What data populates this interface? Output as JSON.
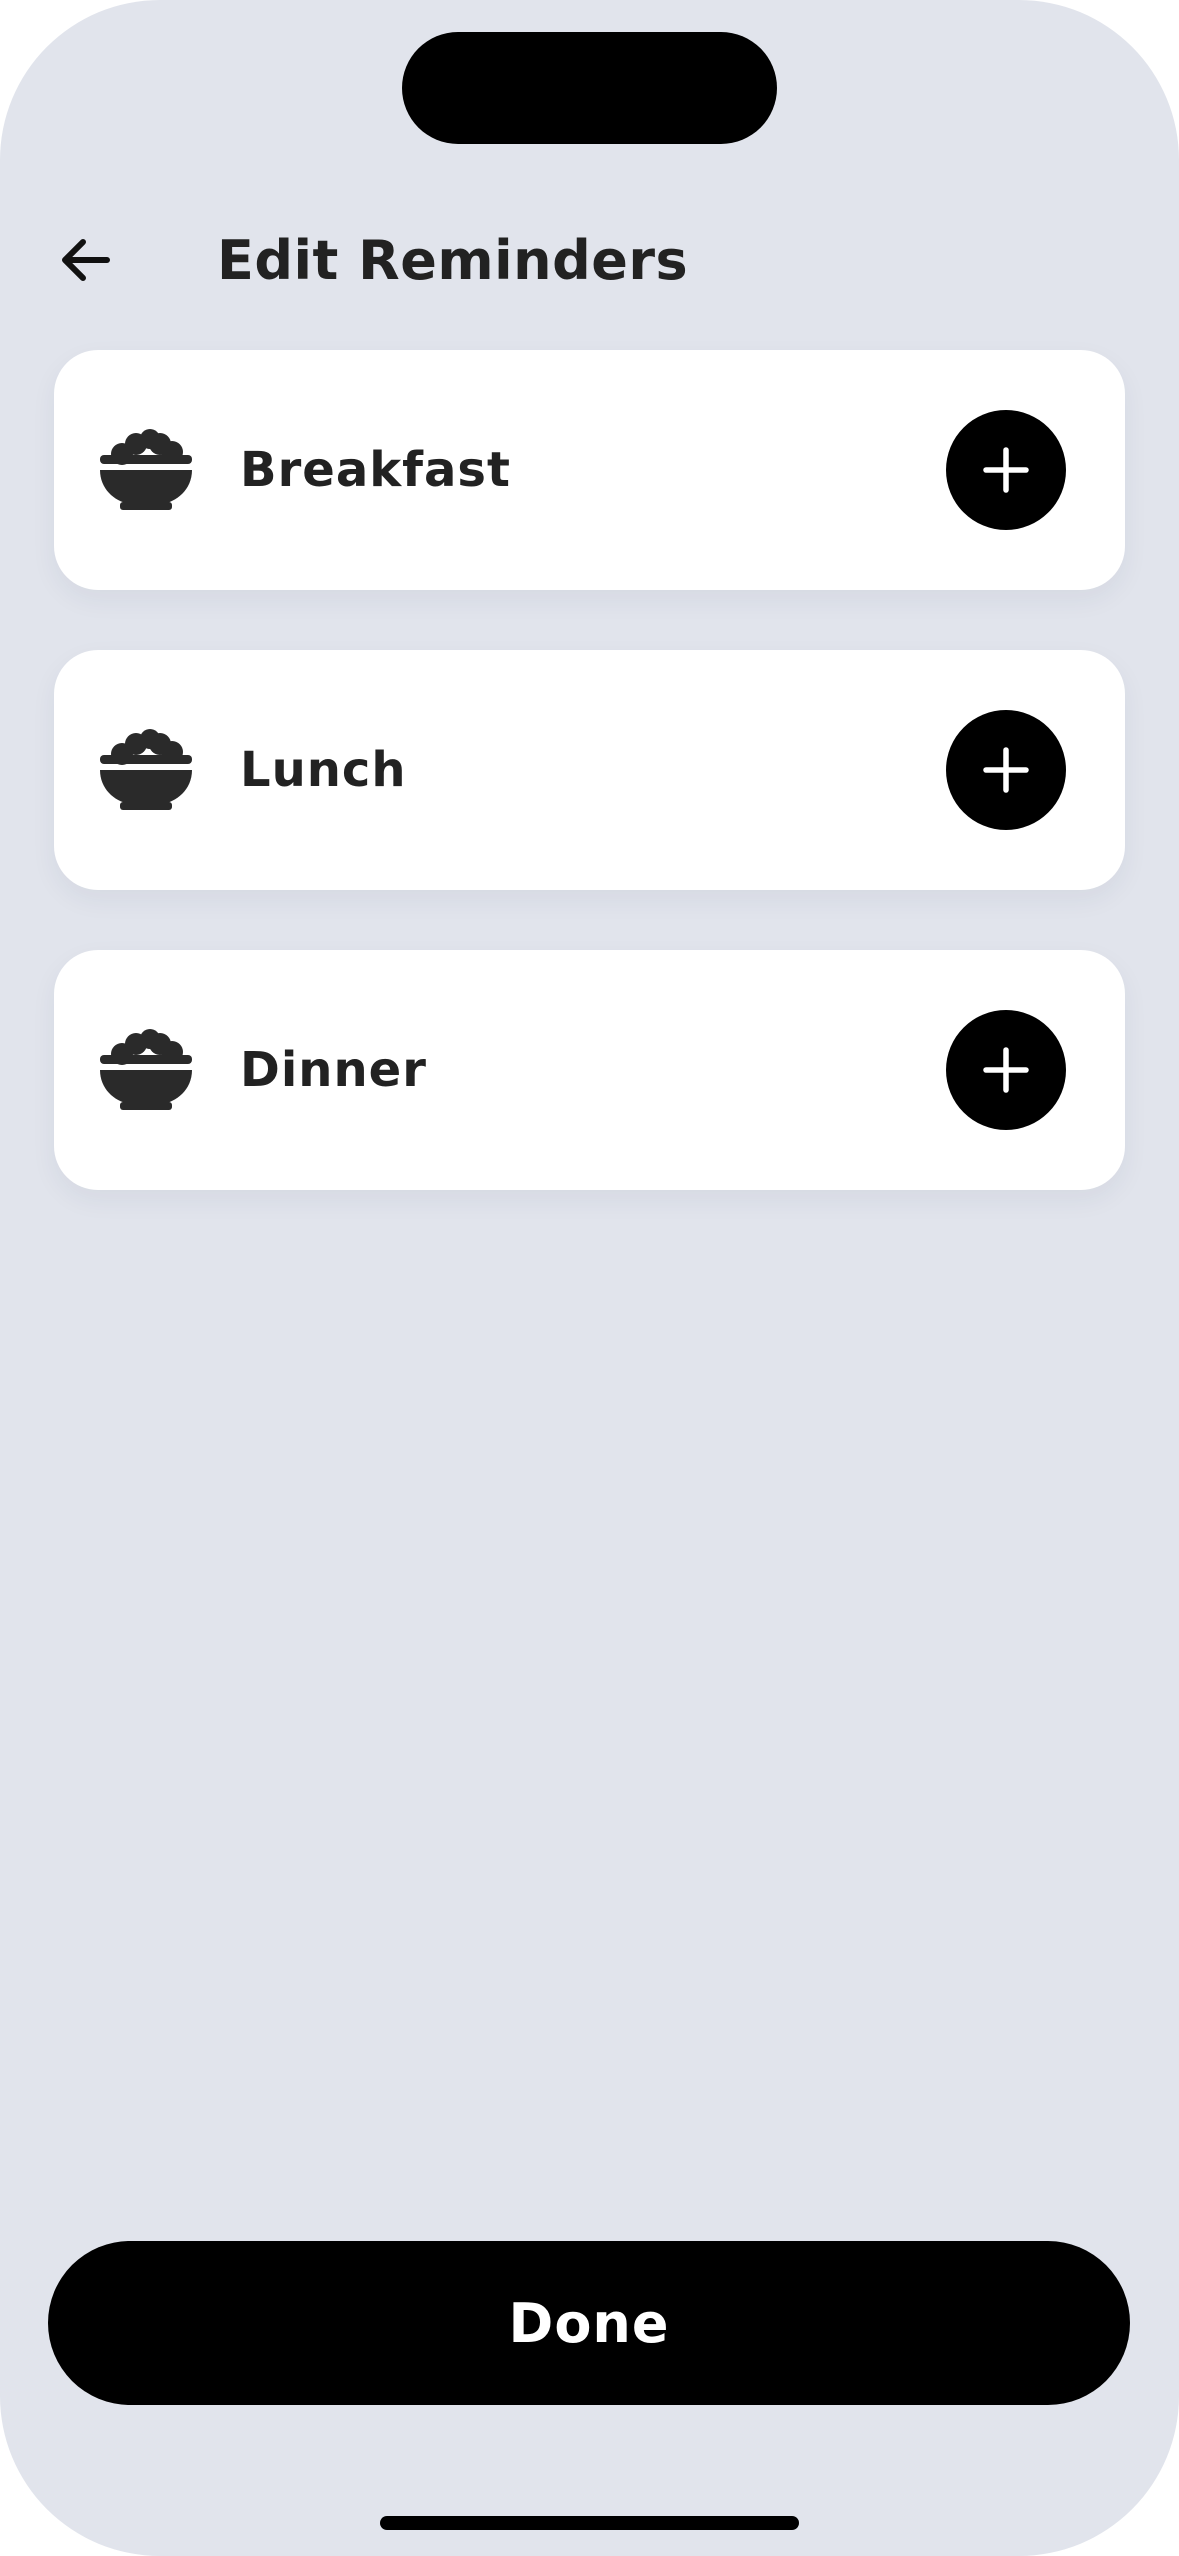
{
  "header": {
    "title": "Edit Reminders",
    "back_icon": "arrow-left-icon"
  },
  "meals": [
    {
      "label": "Breakfast",
      "icon": "rice-bowl-icon",
      "action_icon": "plus-icon"
    },
    {
      "label": "Lunch",
      "icon": "rice-bowl-icon",
      "action_icon": "plus-icon"
    },
    {
      "label": "Dinner",
      "icon": "rice-bowl-icon",
      "action_icon": "plus-icon"
    }
  ],
  "footer": {
    "done_label": "Done"
  },
  "colors": {
    "background": "#e1e4ec",
    "card": "#ffffff",
    "text": "#222222",
    "button": "#000000",
    "button_text": "#ffffff"
  }
}
